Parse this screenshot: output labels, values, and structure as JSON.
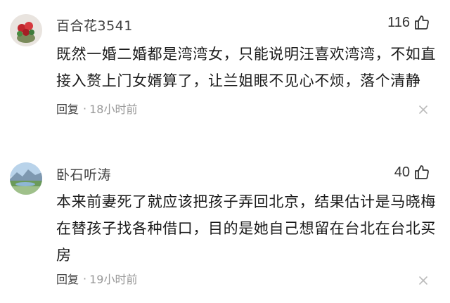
{
  "comments": [
    {
      "username": "百合花3541",
      "likes": "116",
      "text": "既然一婚二婚都是湾湾女，只能说明汪喜欢湾湾，不如直接入赘上门女婿算了，让兰姐眼不见心不烦，落个清静",
      "reply_label": "回复",
      "separator": "·",
      "time": "18小时前",
      "avatar_icon": "flower-avatar-icon"
    },
    {
      "username": "卧石听涛",
      "likes": "40",
      "text": "本来前妻死了就应该把孩子弄回北京，结果估计是马晓梅在替孩子找各种借口，目的是她自己想留在台北在台北买房",
      "reply_label": "回复",
      "separator": "·",
      "time": "19小时前",
      "avatar_icon": "landscape-avatar-icon"
    }
  ],
  "colors": {
    "text": "#1a1a1a",
    "username": "#404040",
    "time": "#999999"
  }
}
